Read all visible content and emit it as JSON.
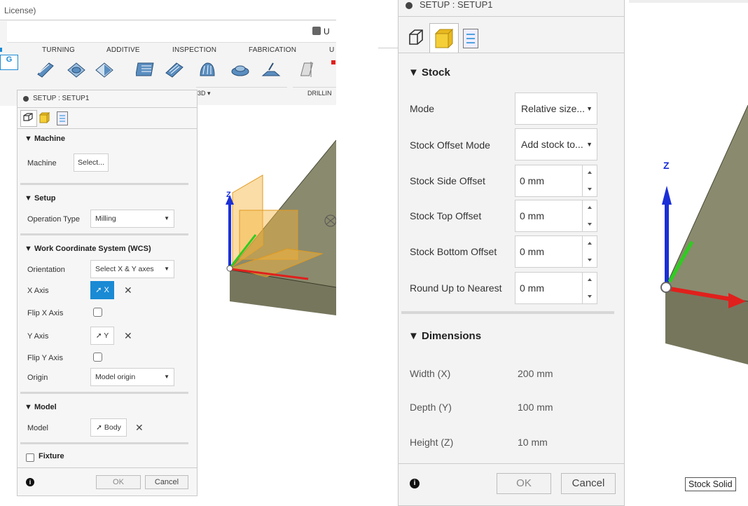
{
  "left": {
    "window_title_partial": "License)",
    "ribbon_tabs": [
      "TURNING",
      "ADDITIVE",
      "INSPECTION",
      "FABRICATION",
      "U"
    ],
    "ribbon_groups": [
      "3D ▾",
      "DRILLIN"
    ],
    "ribbon_left_fragment": "G",
    "right_partial": "U",
    "dialog": {
      "title": "SETUP : SETUP1",
      "sections": {
        "machine": {
          "title": "Machine",
          "label": "Machine",
          "button": "Select..."
        },
        "setup": {
          "title": "Setup",
          "label": "Operation Type",
          "value": "Milling"
        },
        "wcs": {
          "title": "Work Coordinate System (WCS)",
          "orientation_label": "Orientation",
          "orientation_value": "Select X & Y axes",
          "xaxis_label": "X Axis",
          "xaxis_value": "X",
          "flipx_label": "Flip X Axis",
          "yaxis_label": "Y Axis",
          "yaxis_value": "Y",
          "flipy_label": "Flip Y Axis",
          "origin_label": "Origin",
          "origin_value": "Model origin"
        },
        "model": {
          "title": "Model",
          "label": "Model",
          "value": "Body"
        },
        "fixture": {
          "title": "Fixture"
        }
      },
      "ok": "OK",
      "cancel": "Cancel"
    },
    "axis_label": "Z"
  },
  "right": {
    "dialog": {
      "title": "SETUP : SETUP1",
      "stock": {
        "title": "Stock",
        "mode_label": "Mode",
        "mode_value": "Relative size...",
        "offset_mode_label": "Stock Offset Mode",
        "offset_mode_value": "Add stock to...",
        "side_label": "Stock Side Offset",
        "side_value": "0 mm",
        "top_label": "Stock Top Offset",
        "top_value": "0 mm",
        "bottom_label": "Stock Bottom Offset",
        "bottom_value": "0 mm",
        "round_label": "Round Up to Nearest",
        "round_value": "0 mm"
      },
      "dimensions": {
        "title": "Dimensions",
        "width_label": "Width (X)",
        "width_value": "200 mm",
        "depth_label": "Depth (Y)",
        "depth_value": "100 mm",
        "height_label": "Height (Z)",
        "height_value": "10 mm"
      },
      "ok": "OK",
      "cancel": "Cancel"
    },
    "axis_label": "Z",
    "tooltip": "Stock Solid"
  },
  "colors": {
    "accent": "#1a8ad4",
    "axis_blue": "#1a2fd6",
    "axis_red": "#e0201c",
    "axis_green": "#2ecc20",
    "model": "#8a8a6e",
    "stock_preview": "#f3b43c"
  }
}
